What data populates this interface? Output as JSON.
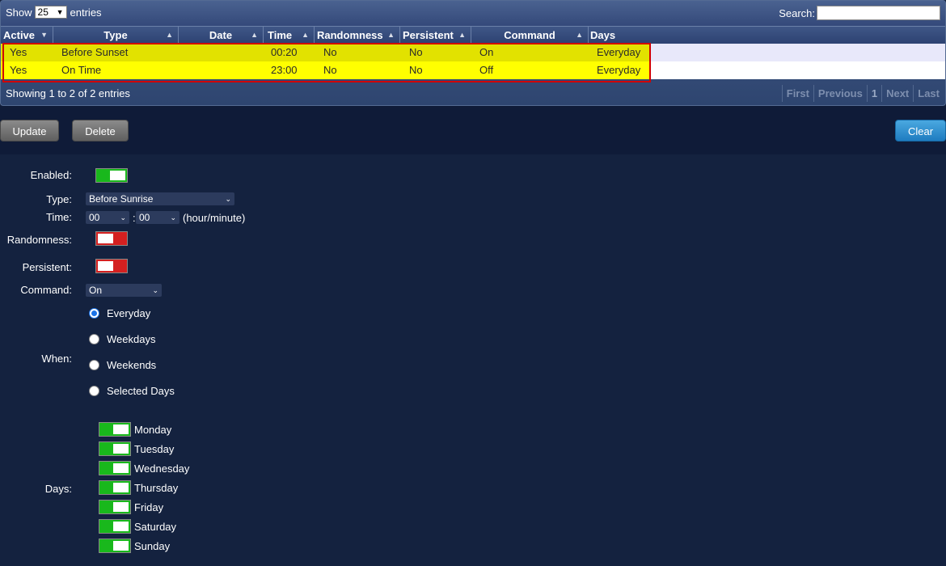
{
  "table": {
    "show_label": "Show",
    "show_value": "25",
    "entries_label": "entries",
    "search_label": "Search:",
    "search_value": "",
    "columns": [
      "Active",
      "Type",
      "Date",
      "Time",
      "Randomness",
      "Persistent",
      "Command",
      "Days"
    ],
    "rows": [
      {
        "active": "Yes",
        "type": "Before Sunset",
        "date": "",
        "time": "00:20",
        "randomness": "No",
        "persistent": "No",
        "command": "On",
        "days": "Everyday"
      },
      {
        "active": "Yes",
        "type": "On Time",
        "date": "",
        "time": "23:00",
        "randomness": "No",
        "persistent": "No",
        "command": "Off",
        "days": "Everyday"
      }
    ],
    "info": "Showing 1 to 2 of 2 entries",
    "pager": {
      "first": "First",
      "previous": "Previous",
      "page": "1",
      "next": "Next",
      "last": "Last"
    }
  },
  "buttons": {
    "update": "Update",
    "delete": "Delete",
    "clear": "Clear"
  },
  "form": {
    "enabled_label": "Enabled:",
    "enabled": true,
    "type_label": "Type:",
    "type_value": "Before Sunrise",
    "time_label": "Time:",
    "hour_value": "00",
    "minute_value": "00",
    "time_separator": ":",
    "time_hint": "(hour/minute)",
    "randomness_label": "Randomness:",
    "randomness": false,
    "persistent_label": "Persistent:",
    "persistent": false,
    "command_label": "Command:",
    "command_value": "On",
    "when_label": "When:",
    "when_options": [
      "Everyday",
      "Weekdays",
      "Weekends",
      "Selected Days"
    ],
    "when_selected": "Everyday",
    "days_label": "Days:",
    "days": [
      "Monday",
      "Tuesday",
      "Wednesday",
      "Thursday",
      "Friday",
      "Saturday",
      "Sunday"
    ]
  },
  "colors": {
    "toggle_on": "#19b81c",
    "toggle_off": "#d42020",
    "highlight": "#ffff00",
    "selection_border": "#d10000"
  }
}
